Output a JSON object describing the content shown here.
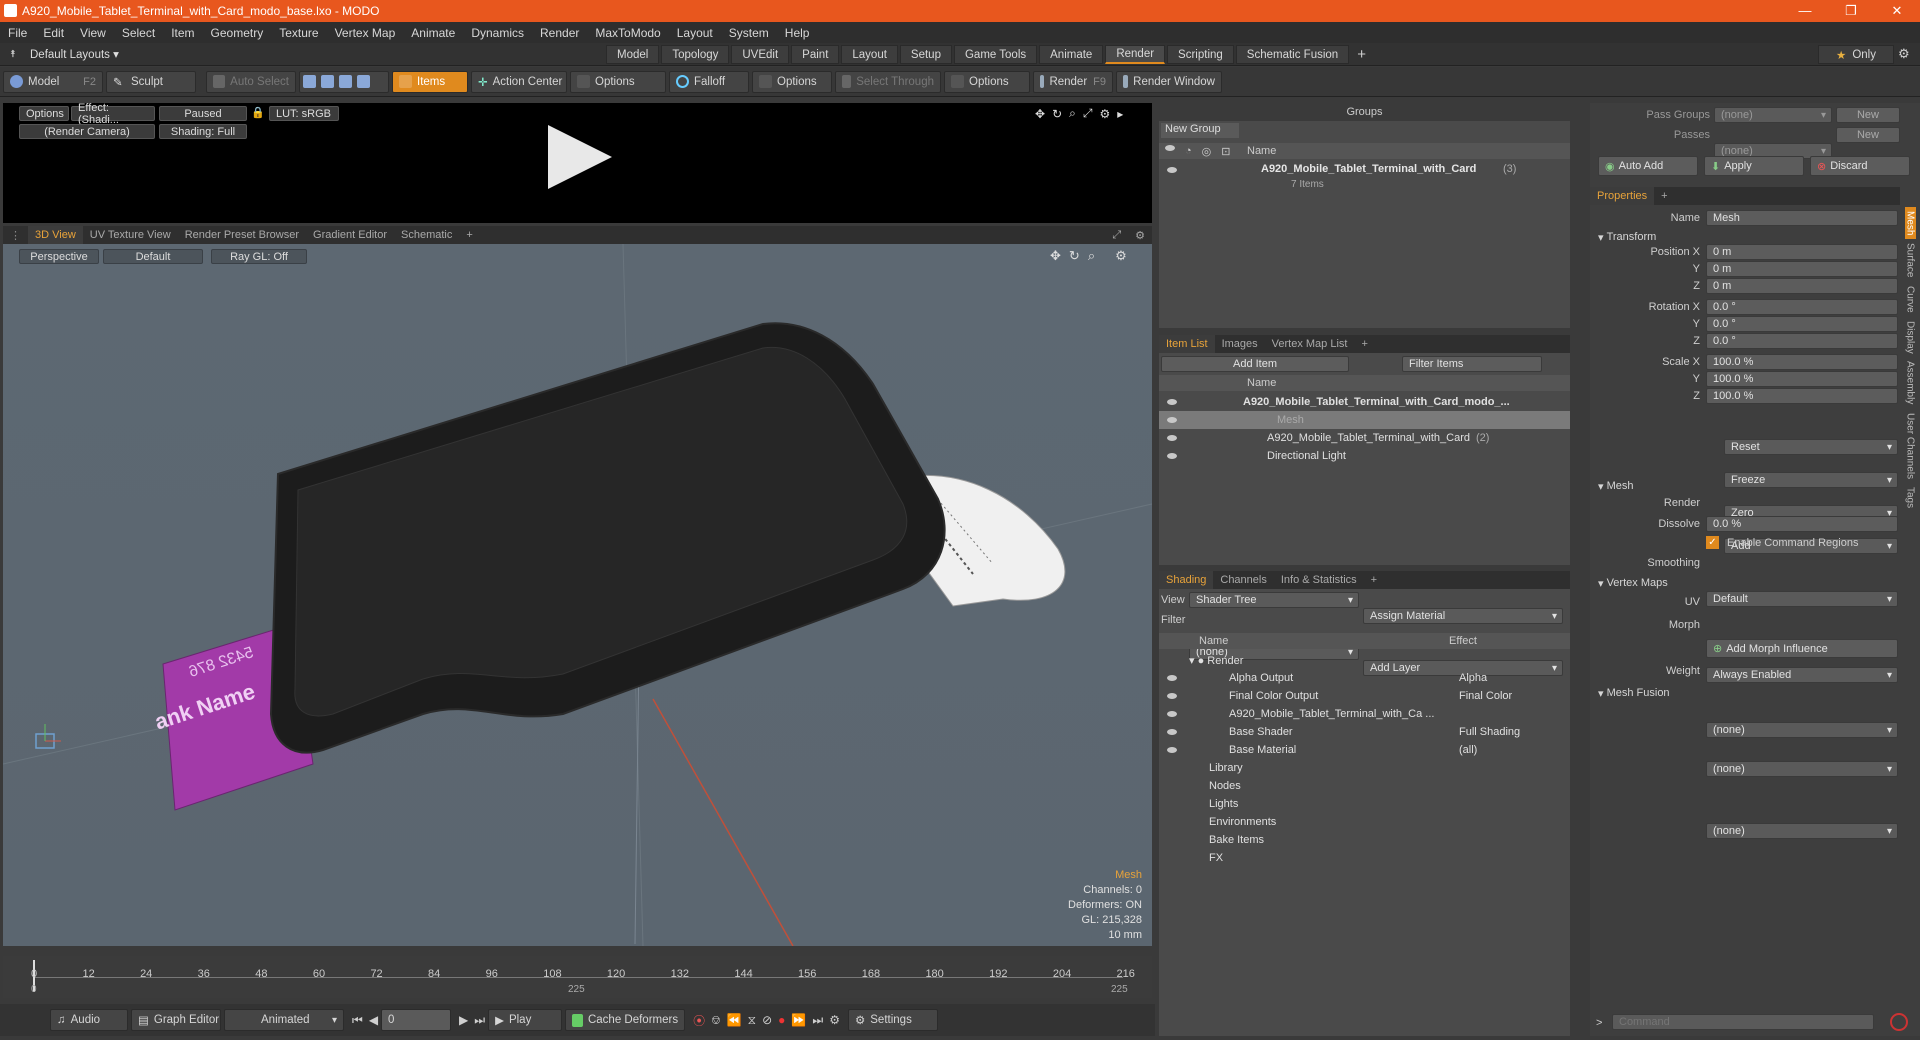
{
  "window": {
    "title": "A920_Mobile_Tablet_Terminal_with_Card_modo_base.lxo - MODO",
    "controls": [
      "—",
      "❐",
      "✕"
    ]
  },
  "menu": [
    "File",
    "Edit",
    "View",
    "Select",
    "Item",
    "Geometry",
    "Texture",
    "Vertex Map",
    "Animate",
    "Dynamics",
    "Render",
    "MaxToModo",
    "Layout",
    "System",
    "Help"
  ],
  "layoutbar": {
    "layouts_label": "Default Layouts ▾",
    "tabs": [
      "Model",
      "Topology",
      "UVEdit",
      "Paint",
      "Layout",
      "Setup",
      "Game Tools",
      "Animate",
      "Render",
      "Scripting",
      "Schematic Fusion"
    ],
    "active_tab": "Render",
    "only_label": "Only"
  },
  "toolbar": {
    "model": "Model",
    "model_key": "F2",
    "sculpt": "Sculpt",
    "auto_select": "Auto Select",
    "items": "Items",
    "action_center": "Action Center",
    "options1": "Options",
    "falloff": "Falloff",
    "options2": "Options",
    "select_through": "Select Through",
    "options3": "Options",
    "render": "Render",
    "render_key": "F9",
    "render_window": "Render Window"
  },
  "preview": {
    "options": "Options",
    "effect": "Effect: (Shadi...",
    "paused": "Paused",
    "lut": "LUT: sRGB",
    "camera": "(Render Camera)",
    "shading": "Shading: Full"
  },
  "viewtabs": [
    "3D View",
    "UV Texture View",
    "Render Preset Browser",
    "Gradient Editor",
    "Schematic"
  ],
  "viewport": {
    "perspective": "Perspective",
    "default": "Default",
    "raygl": "Ray GL: Off",
    "info": {
      "title": "Mesh",
      "channels": "Channels: 0",
      "deformers": "Deformers: ON",
      "gl": "GL: 215,328",
      "scale": "10 mm"
    },
    "card_text1": "ank Name",
    "card_text2": "5432 876"
  },
  "timeline": {
    "ticks": [
      "0",
      "12",
      "24",
      "36",
      "48",
      "60",
      "72",
      "84",
      "96",
      "108",
      "120",
      "132",
      "144",
      "156",
      "168",
      "180",
      "192",
      "204",
      "216"
    ],
    "sub_ticks": [
      "0",
      "225",
      "225"
    ]
  },
  "bottombar": {
    "audio": "Audio",
    "graph_editor": "Graph Editor",
    "animated": "Animated",
    "frame": "0",
    "play": "Play",
    "cache": "Cache Deformers",
    "settings": "Settings"
  },
  "groups": {
    "title": "Groups",
    "new_group": "New Group",
    "name_col": "Name",
    "item": "A920_Mobile_Tablet_Terminal_with_Card",
    "item_count": "(3)",
    "items_sub": "7 Items"
  },
  "itemlist": {
    "tabs": [
      "Item List",
      "Images",
      "Vertex Map List"
    ],
    "add_item": "Add Item",
    "filter": "Filter Items",
    "name_col": "Name",
    "rows": [
      {
        "label": "A920_Mobile_Tablet_Terminal_with_Card_modo_...",
        "bold": true
      },
      {
        "label": "Mesh",
        "dim": true
      },
      {
        "label": "A920_Mobile_Tablet_Terminal_with_Card",
        "extra": "(2)"
      },
      {
        "label": "Directional Light"
      }
    ]
  },
  "shading": {
    "tabs": [
      "Shading",
      "Channels",
      "Info & Statistics"
    ],
    "view_label": "View",
    "view": "Shader Tree",
    "assign": "Assign Material",
    "filter_label": "Filter",
    "filter": "(none)",
    "add_layer": "Add Layer",
    "name_col": "Name",
    "effect_col": "Effect",
    "rows": [
      {
        "name": "Render",
        "effect": ""
      },
      {
        "name": "Alpha Output",
        "effect": "Alpha"
      },
      {
        "name": "Final Color Output",
        "effect": "Final Color"
      },
      {
        "name": "A920_Mobile_Tablet_Terminal_with_Ca ...",
        "effect": ""
      },
      {
        "name": "Base Shader",
        "effect": "Full Shading"
      },
      {
        "name": "Base Material",
        "effect": "(all)"
      },
      {
        "name": "Library",
        "effect": ""
      },
      {
        "name": "Nodes",
        "effect": ""
      },
      {
        "name": "Lights",
        "effect": ""
      },
      {
        "name": "Environments",
        "effect": ""
      },
      {
        "name": "Bake Items",
        "effect": ""
      },
      {
        "name": "FX",
        "effect": ""
      }
    ]
  },
  "right": {
    "pass_groups_label": "Pass Groups",
    "pass_groups": "(none)",
    "passes_label": "Passes",
    "passes": "(none)",
    "new": "New",
    "auto_add": "Auto Add",
    "apply": "Apply",
    "discard": "Discard",
    "properties_tab": "Properties",
    "name_label": "Name",
    "name_value": "Mesh",
    "transform": "Transform",
    "pos_x_label": "Position X",
    "rot_x_label": "Rotation X",
    "scale_x_label": "Scale X",
    "y_label": "Y",
    "z_label": "Z",
    "pos": [
      "0 m",
      "0 m",
      "0 m"
    ],
    "rot": [
      "0.0 °",
      "0.0 °",
      "0.0 °"
    ],
    "scale": [
      "100.0 %",
      "100.0 %",
      "100.0 %"
    ],
    "reset": "Reset",
    "freeze": "Freeze",
    "zero": "Zero",
    "add": "Add",
    "mesh_section": "Mesh",
    "render_label": "Render",
    "render_value": "Default",
    "dissolve_label": "Dissolve",
    "dissolve_value": "0.0 %",
    "enable_cmd": "Enable Command Regions",
    "smoothing_label": "Smoothing",
    "smoothing_value": "Always Enabled",
    "vertex_maps": "Vertex Maps",
    "uv_label": "UV",
    "uv_value": "(none)",
    "morph_label": "Morph",
    "morph_value": "(none)",
    "add_morph": "Add Morph Influence",
    "weight_label": "Weight",
    "weight_value": "(none)",
    "mesh_fusion": "Mesh Fusion",
    "side_tabs": [
      "Mesh",
      "Surface",
      "Curve",
      "Display",
      "Assembly",
      "User Channels",
      "Tags"
    ],
    "command_placeholder": "Command"
  }
}
